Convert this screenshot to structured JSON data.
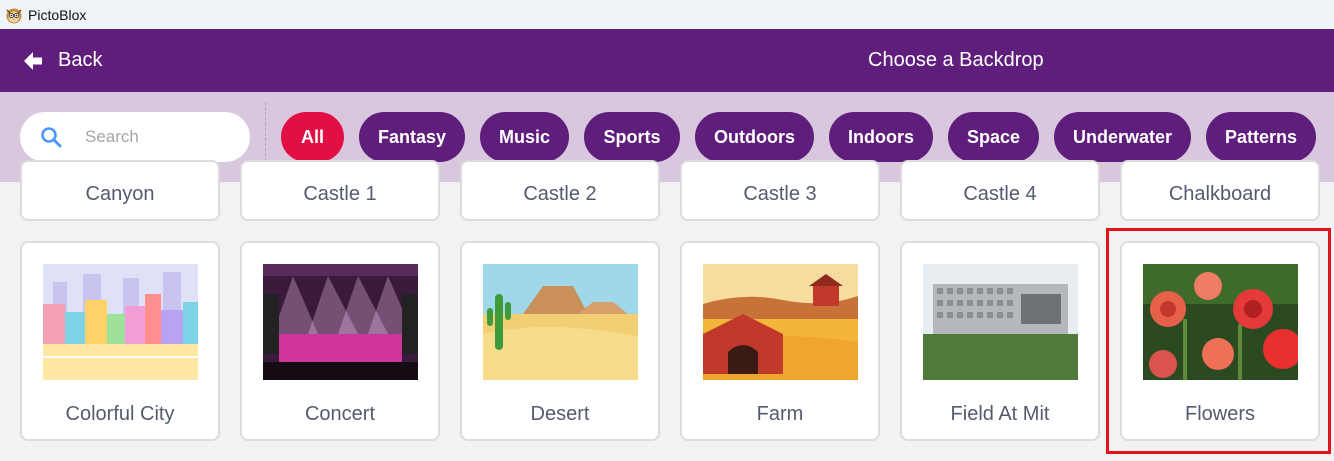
{
  "app": {
    "title": "PictoBlox"
  },
  "header": {
    "back_label": "Back",
    "title": "Choose a Backdrop"
  },
  "search": {
    "placeholder": "Search",
    "value": ""
  },
  "tags": [
    {
      "label": "All",
      "active": true
    },
    {
      "label": "Fantasy"
    },
    {
      "label": "Music"
    },
    {
      "label": "Sports"
    },
    {
      "label": "Outdoors"
    },
    {
      "label": "Indoors"
    },
    {
      "label": "Space"
    },
    {
      "label": "Underwater"
    },
    {
      "label": "Patterns"
    }
  ],
  "backdrops_partial": [
    {
      "name": "Canyon"
    },
    {
      "name": "Castle 1"
    },
    {
      "name": "Castle 2"
    },
    {
      "name": "Castle 3"
    },
    {
      "name": "Castle 4"
    },
    {
      "name": "Chalkboard"
    }
  ],
  "backdrops": [
    {
      "name": "Colorful City"
    },
    {
      "name": "Concert"
    },
    {
      "name": "Desert"
    },
    {
      "name": "Farm"
    },
    {
      "name": "Field At Mit"
    },
    {
      "name": "Flowers",
      "selected": true
    }
  ],
  "colors": {
    "header_purple": "#5f1e7c",
    "active_tag": "#e20f44",
    "selection_outline": "#e3121b",
    "filter_bar": "#d9c8dd"
  }
}
